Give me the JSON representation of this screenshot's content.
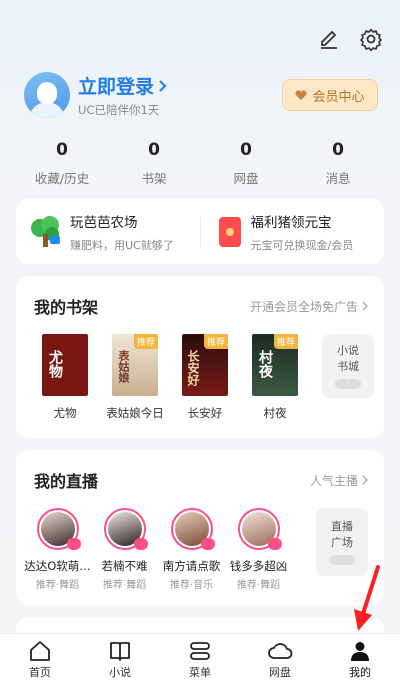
{
  "header": {
    "edit_icon": "edit-icon",
    "settings_icon": "gear-icon"
  },
  "profile": {
    "login_text": "立即登录",
    "subtitle": "UC已陪伴你1天",
    "vip_label": "会员中心"
  },
  "stats": [
    {
      "value": "0",
      "label": "收藏/历史"
    },
    {
      "value": "0",
      "label": "书架"
    },
    {
      "value": "0",
      "label": "网盘"
    },
    {
      "value": "0",
      "label": "消息"
    }
  ],
  "promos": [
    {
      "title": "玩芭芭农场",
      "subtitle": "赚肥料，用UC就够了"
    },
    {
      "title": "福利猪领元宝",
      "subtitle": "元宝可兑换现金/会员"
    }
  ],
  "shelf": {
    "title": "我的书架",
    "link": "开通会员全场免广告",
    "tag": "推荐",
    "books": [
      {
        "name": "尤物",
        "cover_text": "尤物",
        "color": "#7a1612"
      },
      {
        "name": "表姑娘今日",
        "cover_text": "表姑娘",
        "color": "#d9cbb6"
      },
      {
        "name": "长安好",
        "cover_text": "长安好",
        "color": "#5a1414"
      },
      {
        "name": "村夜",
        "cover_text": "村夜",
        "color": "#243a2c"
      }
    ],
    "more_label_1": "小说",
    "more_label_2": "书城"
  },
  "live": {
    "title": "我的直播",
    "link": "人气主播",
    "anchors": [
      {
        "name": "达达O软萌…",
        "category": "推荐·舞蹈"
      },
      {
        "name": "若楠不难",
        "category": "推荐·舞蹈"
      },
      {
        "name": "南方请点歌",
        "category": "推荐·音乐"
      },
      {
        "name": "钱多多超凶",
        "category": "推荐·舞蹈"
      }
    ],
    "more_label_1": "直播",
    "more_label_2": "广场"
  },
  "tabs": [
    {
      "label": "首页",
      "icon": "home-icon"
    },
    {
      "label": "小说",
      "icon": "book-icon"
    },
    {
      "label": "菜单",
      "icon": "menu-icon"
    },
    {
      "label": "网盘",
      "icon": "cloud-icon"
    },
    {
      "label": "我的",
      "icon": "user-icon",
      "active": true
    }
  ],
  "colors": {
    "accent": "#1f7be8",
    "live_ring": "#ff4f86",
    "annotation_arrow": "#ff1f1f"
  }
}
